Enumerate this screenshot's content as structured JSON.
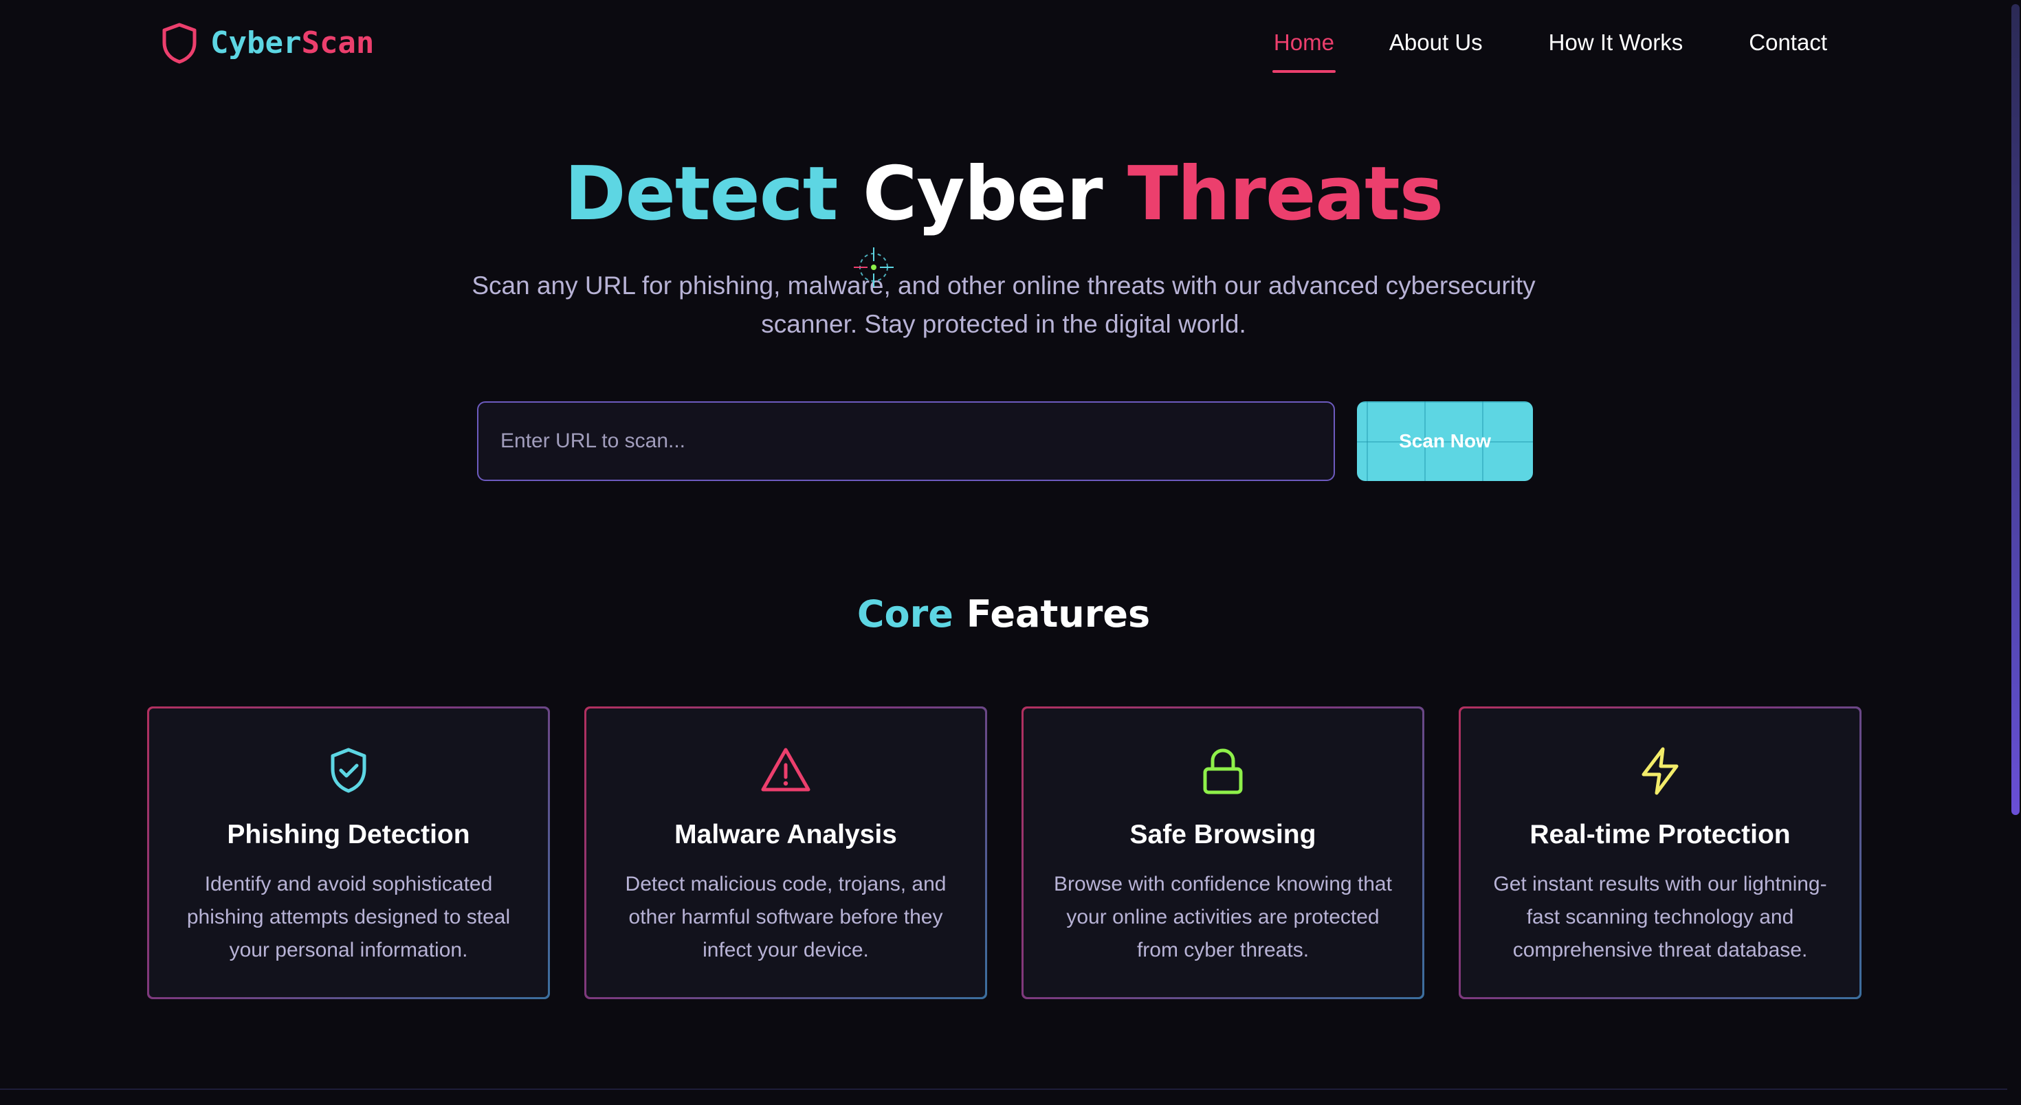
{
  "brand": {
    "name_part1": "Cyber",
    "name_part2": "Scan",
    "logo_icon": "shield-icon"
  },
  "nav": {
    "items": [
      {
        "label": "Home",
        "active": true
      },
      {
        "label": "About Us",
        "active": false
      },
      {
        "label": "How It Works",
        "active": false
      },
      {
        "label": "Contact",
        "active": false
      }
    ]
  },
  "hero": {
    "title_part1": "Detect",
    "title_part2": "Cyber",
    "title_part3": "Threats",
    "subtitle": "Scan any URL for phishing, malware, and other online threats with our advanced cybersecurity scanner. Stay protected in the digital world."
  },
  "search": {
    "placeholder": "Enter URL to scan...",
    "value": "",
    "button_label": "Scan Now"
  },
  "features": {
    "title_part1": "Core",
    "title_part2": "Features",
    "cards": [
      {
        "icon": "shield-check-icon",
        "title": "Phishing Detection",
        "description": "Identify and avoid sophisticated phishing attempts designed to steal your personal information."
      },
      {
        "icon": "alert-triangle-icon",
        "title": "Malware Analysis",
        "description": "Detect malicious code, trojans, and other harmful software before they infect your device."
      },
      {
        "icon": "lock-icon",
        "title": "Safe Browsing",
        "description": "Browse with confidence knowing that your online activities are protected from cyber threats."
      },
      {
        "icon": "lightning-icon",
        "title": "Real-time Protection",
        "description": "Get instant results with our lightning-fast scanning technology and comprehensive threat database."
      }
    ]
  },
  "colors": {
    "background": "#0b0a10",
    "cyan_accent": "#5dd6e3",
    "pink_accent": "#ec3f6d",
    "green_accent": "#8ef04a",
    "yellow_accent": "#f3ec6a",
    "muted_text": "#b8b3d6",
    "input_border": "#6d5bbf"
  }
}
